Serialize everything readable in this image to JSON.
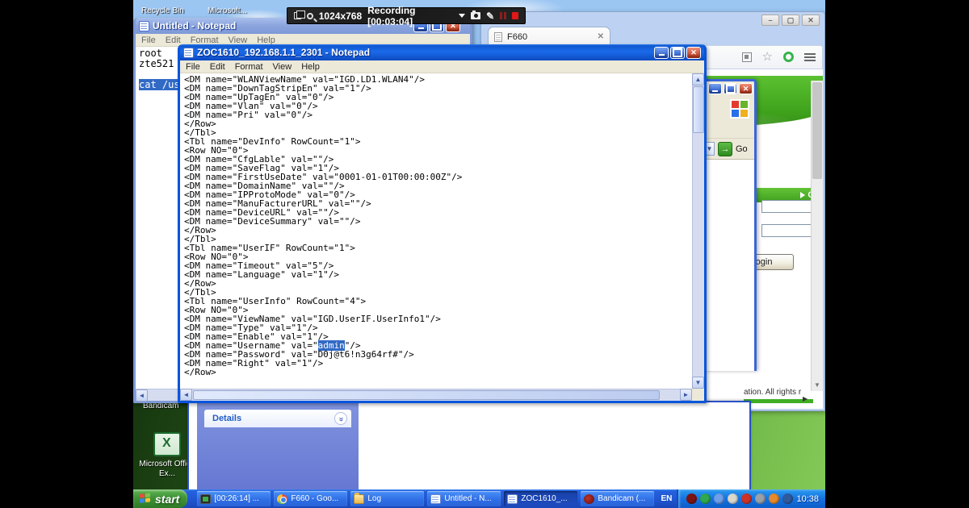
{
  "recording_bar": {
    "resolution": "1024x768",
    "status": "Recording [00:03:04]"
  },
  "desktop": {
    "top_icons": [
      {
        "label": "Recycle Bin"
      },
      {
        "label": "Microsoft..."
      }
    ],
    "bottom_icons": [
      {
        "label": "Bandicam"
      },
      {
        "label": "Microsoft Office Ex..."
      }
    ]
  },
  "untitled_notepad": {
    "title": "Untitled - Notepad",
    "menu": [
      "File",
      "Edit",
      "Format",
      "View",
      "Help"
    ],
    "lines": [
      "root",
      "zte521",
      ""
    ],
    "selected_text": "cat /use"
  },
  "zoc_notepad": {
    "title": "ZOC1610_192.168.1.1_2301 - Notepad",
    "menu": [
      "File",
      "Edit",
      "Format",
      "View",
      "Help"
    ],
    "lines": [
      "<DM name=\"WLANViewName\" val=\"IGD.LD1.WLAN4\"/>",
      "<DM name=\"DownTagStripEn\" val=\"1\"/>",
      "<DM name=\"UpTagEn\" val=\"0\"/>",
      "<DM name=\"Vlan\" val=\"0\"/>",
      "<DM name=\"Pri\" val=\"0\"/>",
      "</Row>",
      "</Tbl>",
      "<Tbl name=\"DevInfo\" RowCount=\"1\">",
      "<Row NO=\"0\">",
      "<DM name=\"CfgLable\" val=\"\"/>",
      "<DM name=\"SaveFlag\" val=\"1\"/>",
      "<DM name=\"FirstUseDate\" val=\"0001-01-01T00:00:00Z\"/>",
      "<DM name=\"DomainName\" val=\"\"/>",
      "<DM name=\"IPProtoMode\" val=\"0\"/>",
      "<DM name=\"ManuFacturerURL\" val=\"\"/>",
      "<DM name=\"DeviceURL\" val=\"\"/>",
      "<DM name=\"DeviceSummary\" val=\"\"/>",
      "</Row>",
      "</Tbl>",
      "<Tbl name=\"UserIF\" RowCount=\"1\">",
      "<Row NO=\"0\">",
      "<DM name=\"Timeout\" val=\"5\"/>",
      "<DM name=\"Language\" val=\"1\"/>",
      "</Row>",
      "</Tbl>",
      "<Tbl name=\"UserInfo\" RowCount=\"4\">",
      "<Row NO=\"0\">",
      "<DM name=\"ViewName\" val=\"IGD.UserIF.UserInfo1\"/>",
      "<DM name=\"Type\" val=\"1\"/>",
      "<DM name=\"Enable\" val=\"1\"/>",
      "<DM name=\"Username\" val=\"admin\"/>",
      "<DM name=\"Password\" val=\"D0j@t6!n3g64rf#\"/>",
      "<DM name=\"Right\" val=\"1\"/>",
      "</Row>"
    ],
    "highlight": {
      "line_index": 30,
      "pre": "<DM name=\"Username\" val=\"",
      "sel": "admin",
      "post": "\"/>"
    }
  },
  "ie_window": {
    "go_label": "Go"
  },
  "browser": {
    "tab_title": "F660",
    "page": {
      "change_link": "Ch",
      "login_button": "Login",
      "copyright": "ation. All rights r"
    }
  },
  "explorer": {
    "details_label": "Details"
  },
  "taskbar": {
    "start_label": "start",
    "buttons": [
      {
        "label": "[00:26:14] ...",
        "icon": "monitor-icon",
        "active": false
      },
      {
        "label": "F660 - Goo...",
        "icon": "chrome-icon",
        "active": false
      },
      {
        "label": "Log",
        "icon": "folder-icon",
        "active": false
      },
      {
        "label": "Untitled - N...",
        "icon": "notepad-icon",
        "active": false
      },
      {
        "label": "ZOC1610_...",
        "icon": "notepad-icon",
        "active": true
      },
      {
        "label": "Bandicam (...",
        "icon": "bandicam-icon",
        "active": false
      }
    ],
    "language": "EN",
    "clock": "10:38",
    "tray_icons": [
      {
        "name": "bandicam-tray-icon",
        "color": "#7d1412"
      },
      {
        "name": "green-app-tray-icon",
        "color": "#2fa84f"
      },
      {
        "name": "network-computers-tray-icon",
        "color": "#6f9fe8"
      },
      {
        "name": "white-app-tray-icon",
        "color": "#ddd8cc"
      },
      {
        "name": "security-alert-tray-icon",
        "color": "#cc3328"
      },
      {
        "name": "gray-app-tray-icon",
        "color": "#9aa0a8"
      },
      {
        "name": "volume-tray-icon",
        "color": "#e8892a"
      },
      {
        "name": "display-tray-icon",
        "color": "#2f5a9e"
      }
    ]
  }
}
